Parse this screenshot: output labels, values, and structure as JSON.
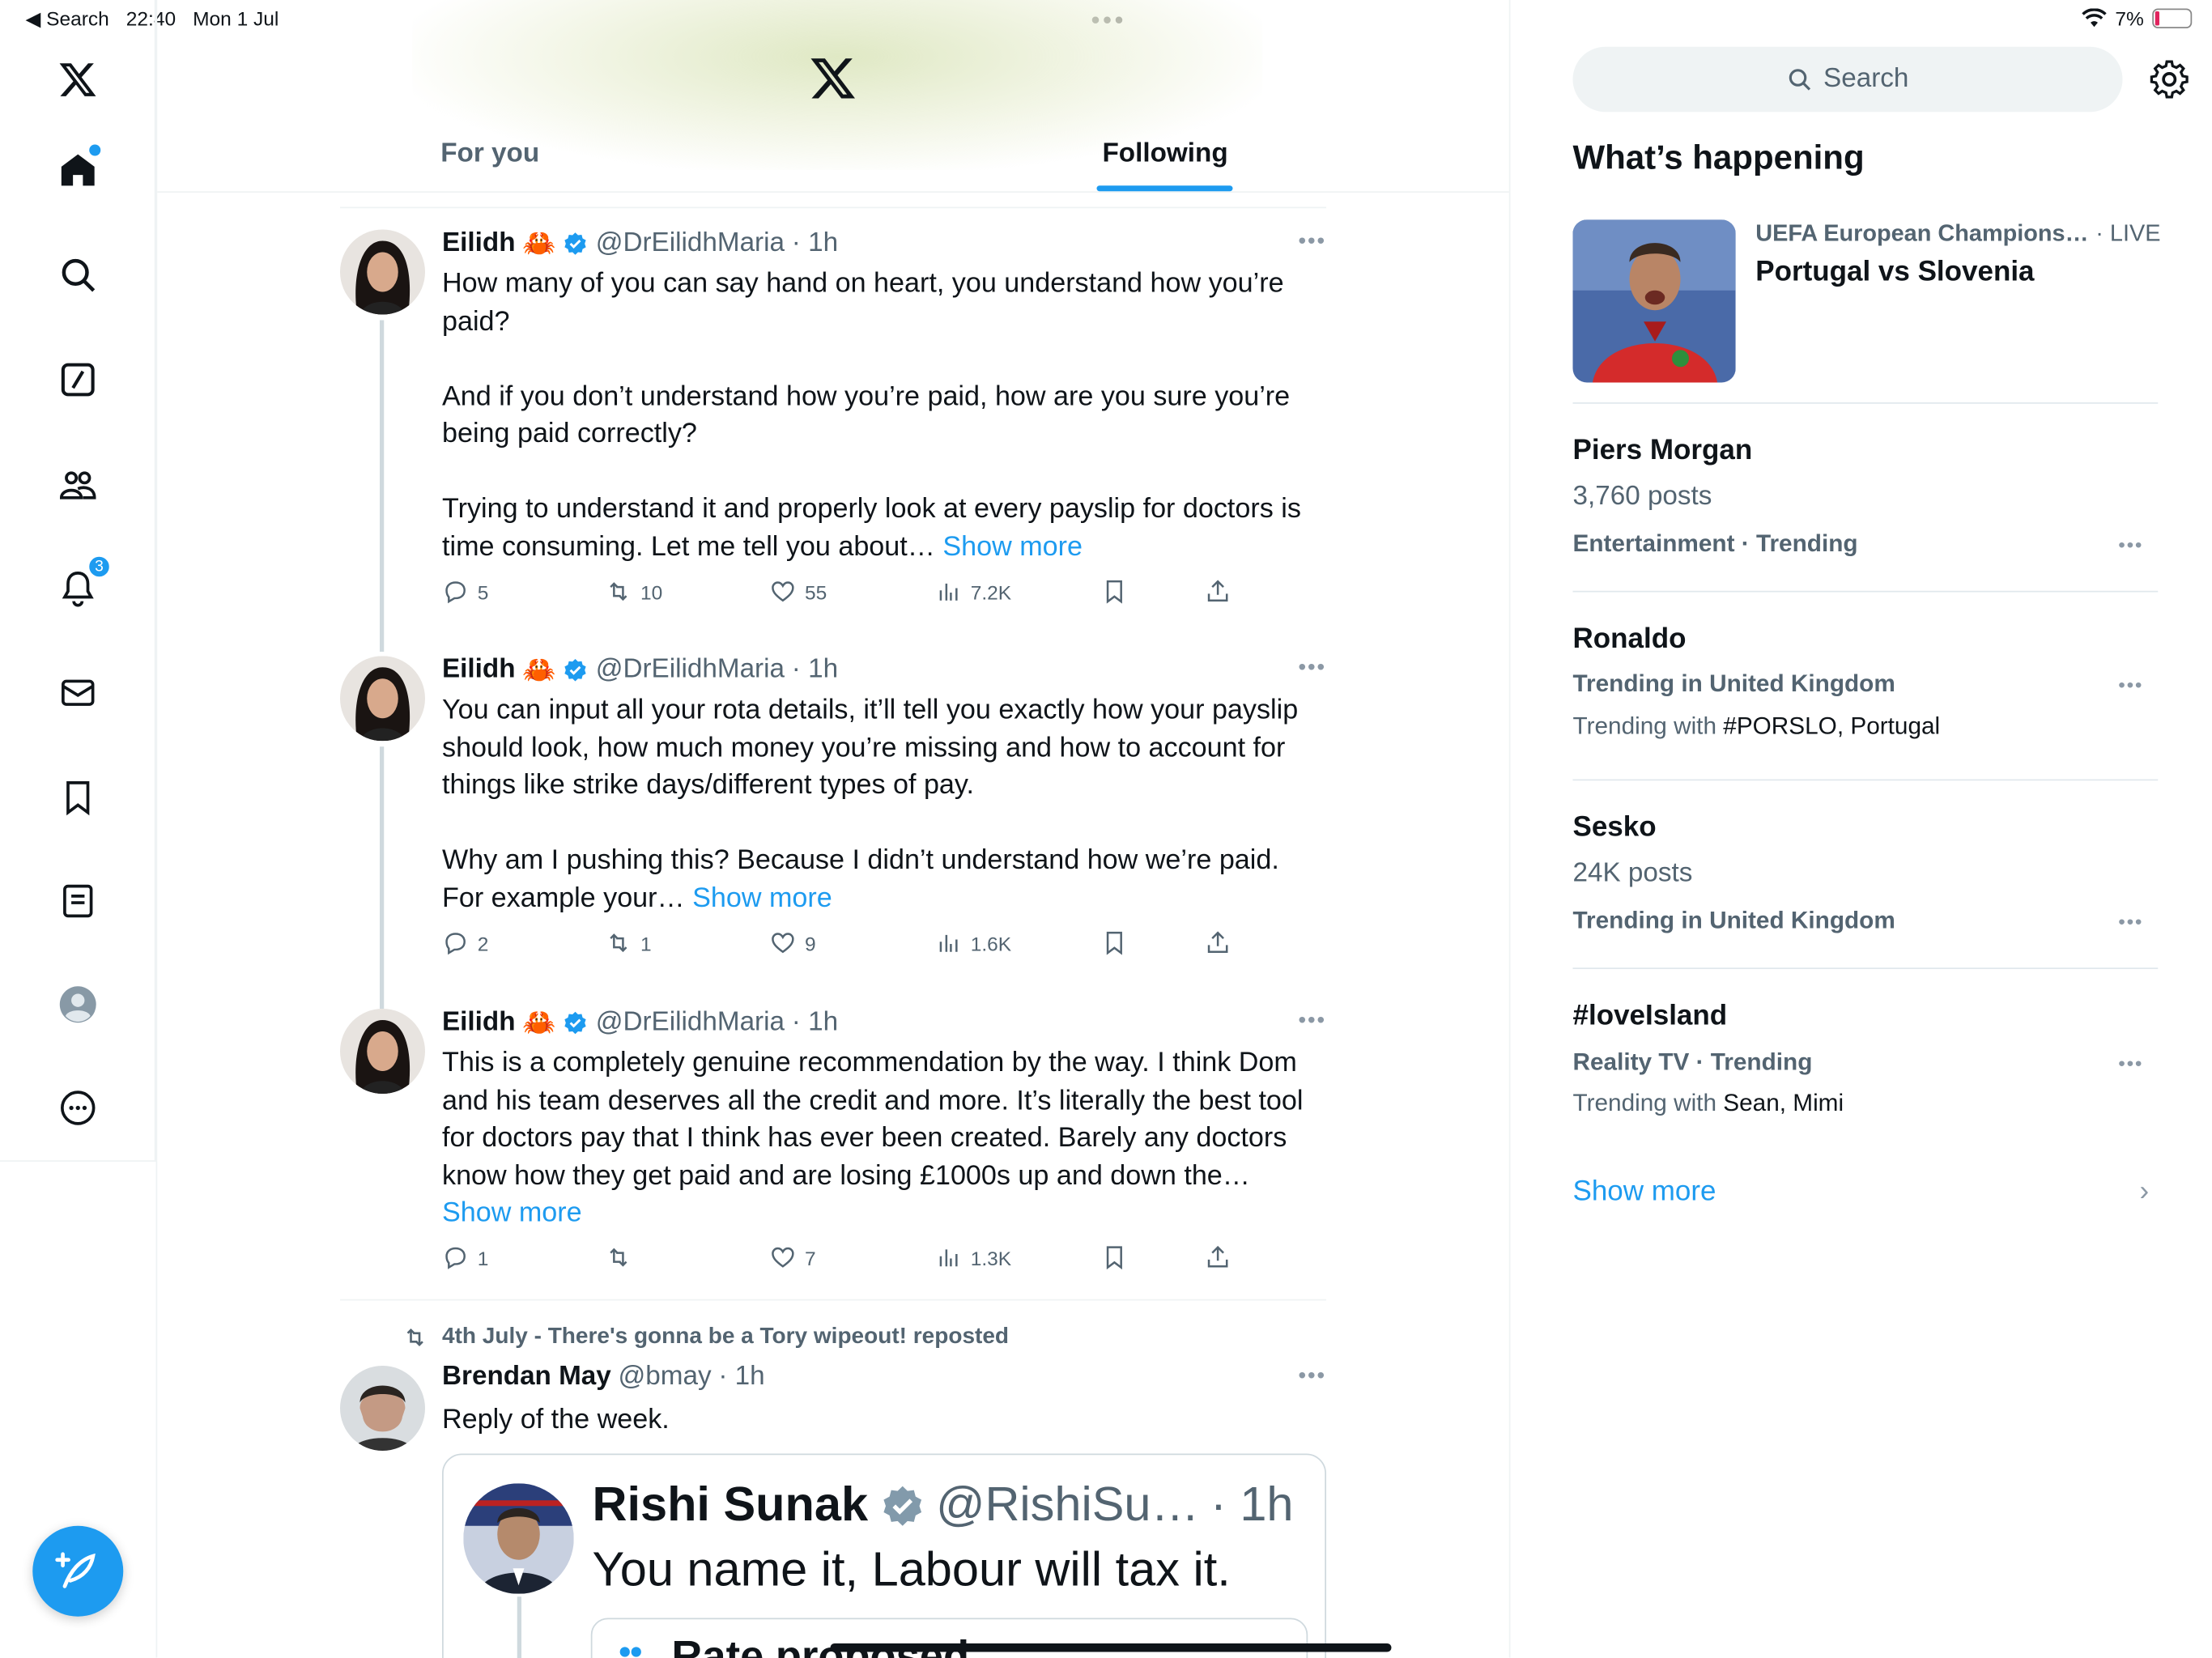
{
  "status": {
    "back_label": "◀ Search",
    "time": "22:40",
    "date": "Mon 1 Jul",
    "battery": "7%"
  },
  "header": {
    "tabs": [
      {
        "label": "For you",
        "active": false
      },
      {
        "label": "Following",
        "active": true
      }
    ]
  },
  "tweets": [
    {
      "name": "Eilidh",
      "emoji": "🦀",
      "handle": "@DrEilidhMaria",
      "time": "· 1h",
      "text": "How many of you can say hand on heart, you understand how you’re paid?\n\nAnd if you don’t understand how you’re paid, how are you sure you’re being paid correctly?\n\nTrying to understand it and properly look at every payslip for doctors is time consuming. Let me tell you about… ",
      "show_more": "Show more",
      "replies": "5",
      "reposts": "10",
      "likes": "55",
      "views": "7.2K"
    },
    {
      "name": "Eilidh",
      "emoji": "🦀",
      "handle": "@DrEilidhMaria",
      "time": "· 1h",
      "text": "You can input all your rota details, it’ll tell you exactly how your payslip should look, how much money you’re missing and how to account for things like strike days/different types of pay.\n\nWhy am I pushing this? Because I didn’t understand how we’re paid. For example your… ",
      "show_more": "Show more",
      "replies": "2",
      "reposts": "1",
      "likes": "9",
      "views": "1.6K"
    },
    {
      "name": "Eilidh",
      "emoji": "🦀",
      "handle": "@DrEilidhMaria",
      "time": "· 1h",
      "text": "This is a completely genuine recommendation by the way. I think Dom and his team deserves all the credit and more. It’s literally the best tool for doctors pay that I think has ever been created. Barely any doctors know how they get paid and are losing £1000s up and down the… ",
      "show_more": "Show more",
      "replies": "1",
      "reposts": "",
      "likes": "7",
      "views": "1.3K"
    },
    {
      "repost_label": "4th July - There's gonna be a Tory wipeout! reposted",
      "name": "Brendan May",
      "handle": "@bmay",
      "time": "· 1h",
      "text": "Reply of the week."
    }
  ],
  "quote": {
    "name": "Rishi Sunak",
    "handle": "@RishiSu…",
    "time": "· 1h",
    "text": "You name it, Labour will tax it.",
    "card_title": "Rate proposed"
  },
  "sidebar": {
    "search_placeholder": "Search",
    "section_title": "What’s happening",
    "featured": {
      "category": "UEFA European Champions…",
      "live": "· LIVE",
      "headline": "Portugal vs Slovenia"
    },
    "trends": [
      {
        "title": "Piers Morgan",
        "posts": "3,760 posts",
        "category": "Entertainment · Trending"
      },
      {
        "title": "Ronaldo",
        "category": "Trending in United Kingdom",
        "with_prefix": "Trending with ",
        "with": "#PORSLO, Portugal"
      },
      {
        "title": "Sesko",
        "posts": "24K posts",
        "category": "Trending in United Kingdom"
      },
      {
        "title": "#loveIsland",
        "category": "Reality TV · Trending",
        "with_prefix": "Trending with ",
        "with": "Sean, Mimi"
      }
    ],
    "show_more": "Show more"
  },
  "nav": {
    "notifications_count": "3"
  },
  "colors": {
    "accent": "#1d9bf0",
    "text": "#0f1419",
    "muted": "#536471"
  }
}
